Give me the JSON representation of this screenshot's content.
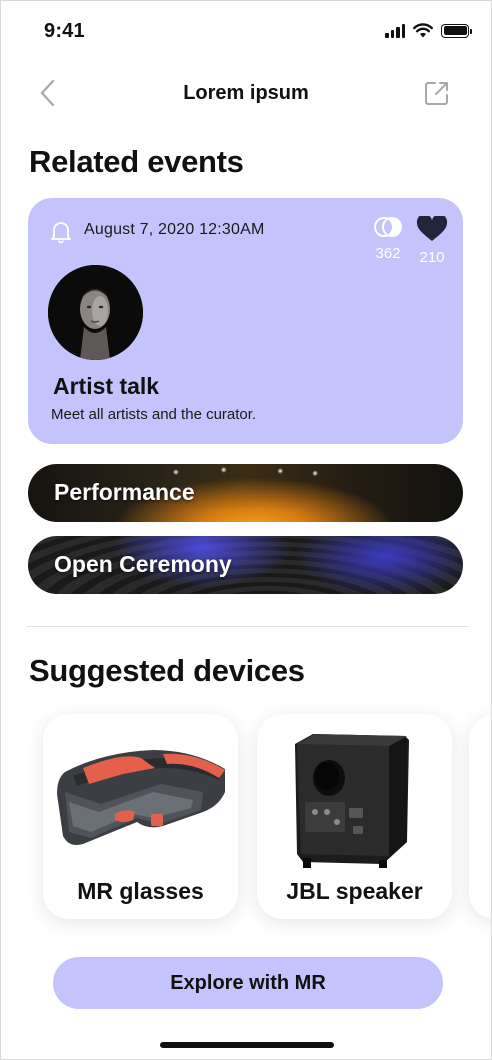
{
  "status_bar": {
    "time": "9:41"
  },
  "nav": {
    "title": "Lorem ipsum"
  },
  "related_events": {
    "heading": "Related events",
    "featured": {
      "date": "August 7, 2020 12:30AM",
      "attendees_count": "362",
      "likes_count": "210",
      "title": "Artist talk",
      "description": "Meet all artists and the curator."
    },
    "items": [
      {
        "label": "Performance"
      },
      {
        "label": "Open Ceremony"
      }
    ]
  },
  "suggested_devices": {
    "heading": "Suggested devices",
    "items": [
      {
        "label": "MR glasses",
        "icon": "mr-glasses-image"
      },
      {
        "label": "JBL speaker",
        "icon": "speaker-image"
      }
    ]
  },
  "cta": {
    "label": "Explore with MR"
  },
  "colors": {
    "accent": "#c5c3fb",
    "text": "#111111",
    "white": "#ffffff"
  }
}
